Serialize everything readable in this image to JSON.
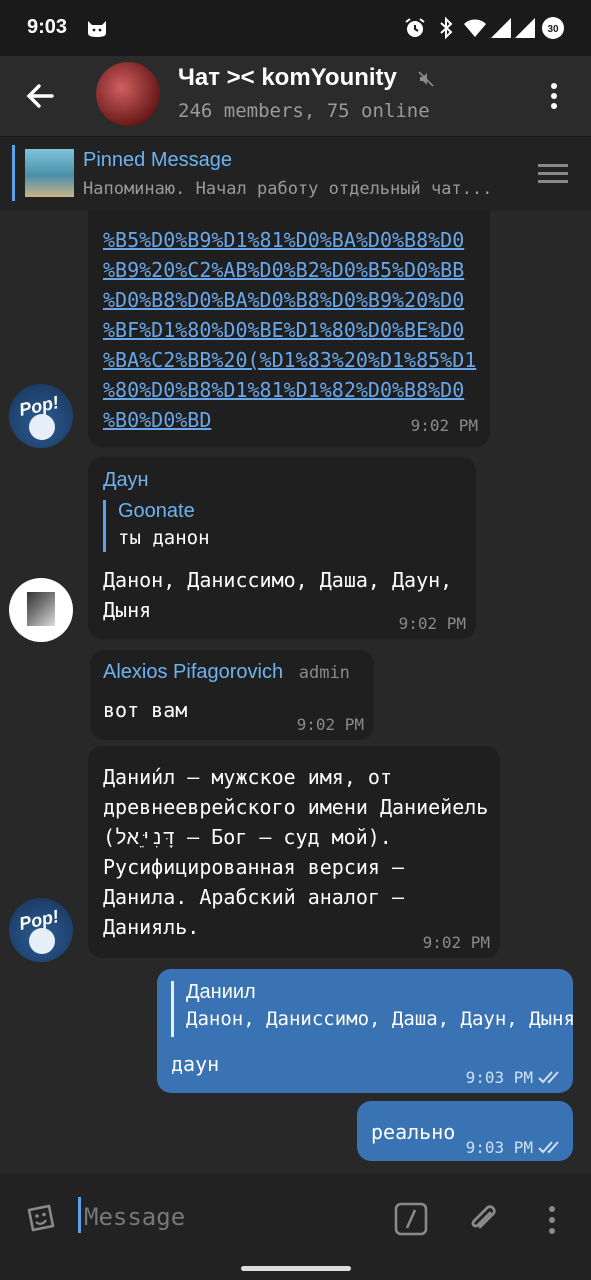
{
  "status_bar": {
    "time": "9:03",
    "battery": "30"
  },
  "header": {
    "title": "Чат >< komYounity",
    "subtitle": "246 members, 75 online"
  },
  "pinned": {
    "title": "Pinned Message",
    "text": "Напоминаю. Начал работу отдельный чат..."
  },
  "messages": {
    "m1": {
      "link_text": "%B5%D0%B9%D1%81%D0%BA%D0%B8%D0\n%B9%20%C2%AB%D0%B2%D0%B5%D0%BB\n%D0%B8%D0%BA%D0%B8%D0%B9%20%D0\n%BF%D1%80%D0%BE%D1%80%D0%BE%D0\n%BA%C2%BB%20(%D1%83%20%D1%85%D1\n%80%D0%B8%D1%81%D1%82%D0%B8%D0\n%B0%D0%BD",
      "time": "9:02 PM"
    },
    "m2": {
      "sender": "Даун",
      "reply_name": "Goonate",
      "reply_text": "ты данон",
      "text": "Данон, Даниссимо, Даша, Даун,\nДыня",
      "time": "9:02 PM"
    },
    "m3": {
      "sender": "Alexios Pifagorovich",
      "badge": "admin",
      "text": "вот вам",
      "time": "9:02 PM"
    },
    "m4": {
      "text": "Дании́л — мужское имя, от\nдревнееврейского имени Даниейель\n(דָּנִיֵּאל — Бог — суд мой).\nРусифицированная версия —\nДанила. Арабский аналог —\nДанияль.",
      "time": "9:02 PM"
    },
    "m5": {
      "reply_name": "Даниил",
      "reply_text": "Данон, Даниссимо, Даша, Даун, Дыня",
      "text": "даун",
      "time": "9:03 PM"
    },
    "m6": {
      "text": "реально",
      "time": "9:03 PM"
    }
  },
  "input": {
    "placeholder": "Message"
  },
  "colors": {
    "accent": "#6db3f2",
    "outgoing": "#3a73b3",
    "incoming": "#1f1f1f",
    "background": "#282828"
  }
}
